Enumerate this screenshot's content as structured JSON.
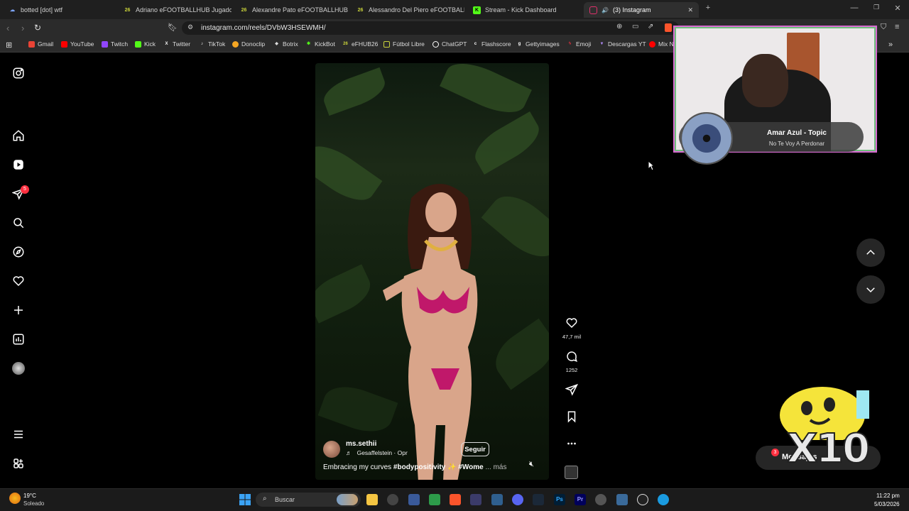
{
  "browser": {
    "tabs": [
      {
        "label": "botted [dot] wtf",
        "favicon": "bot-icon",
        "color": "#7fa7ff"
      },
      {
        "label": "Adriano eFOOTBALLHUB Jugadores",
        "favicon": "26",
        "color": "#c8d23a"
      },
      {
        "label": "Alexandre Pato eFOOTBALLHUB Juga",
        "favicon": "26",
        "color": "#c8d23a"
      },
      {
        "label": "Alessandro Del Piero eFOOTBALLH",
        "favicon": "26",
        "color": "#c8d23a"
      },
      {
        "label": "Stream - Kick Dashboard",
        "favicon": "K",
        "color": "#53fc18"
      },
      {
        "label": "(3) Instagram",
        "favicon": "instagram-icon",
        "color": "#e1306c"
      }
    ],
    "url": "instagram.com/reels/DVbW3HSEWMH/",
    "bookmarks": [
      {
        "label": "Gmail",
        "color": "#ea4335"
      },
      {
        "label": "YouTube",
        "color": "#ff0000"
      },
      {
        "label": "Twitch",
        "color": "#9146ff"
      },
      {
        "label": "Kick",
        "color": "#53fc18"
      },
      {
        "label": "Twitter",
        "color": "#ffffff"
      },
      {
        "label": "TikTok",
        "color": "#ffffff"
      },
      {
        "label": "Donoclip",
        "color": "#f5a623"
      },
      {
        "label": "Botrix",
        "color": "#dddddd"
      },
      {
        "label": "KickBot",
        "color": "#53fc18"
      },
      {
        "label": "eFHUB26",
        "color": "#c8d23a"
      },
      {
        "label": "Fútbol Libre",
        "color": "#c8d23a"
      },
      {
        "label": "ChatGPT",
        "color": "#ffffff"
      },
      {
        "label": "Flashscore",
        "color": "#ffffff"
      },
      {
        "label": "Gettyimages",
        "color": "#ffffff"
      },
      {
        "label": "Emoji",
        "color": "#ff3040"
      },
      {
        "label": "Descargas YT",
        "color": "#b48cff"
      },
      {
        "label": "Mix N",
        "color": "#ff0000"
      }
    ]
  },
  "instagram": {
    "notification_count": "5",
    "reel": {
      "username": "ms.sethii",
      "audio": "Gesaffelstein · Opr",
      "follow_label": "Seguir",
      "caption_text": "Embracing my curves ",
      "caption_tag1": "#bodypositivity",
      "caption_emoji": " ✨ ",
      "caption_tag2": "#Wome",
      "caption_more": " ... más",
      "likes": "47,7 mil",
      "comments": "1252"
    },
    "messages": {
      "label": "Mensajes",
      "badge": "3"
    }
  },
  "overlay": {
    "now_playing_title": "Amar Azul - Topic",
    "now_playing_song": "No Te Voy A Perdonar",
    "mascot_text": "X10"
  },
  "taskbar": {
    "weather_temp": "19°C",
    "weather_desc": "Soleado",
    "search_label": "Buscar",
    "time": "11:22 pm",
    "date": "5/03/2026"
  }
}
